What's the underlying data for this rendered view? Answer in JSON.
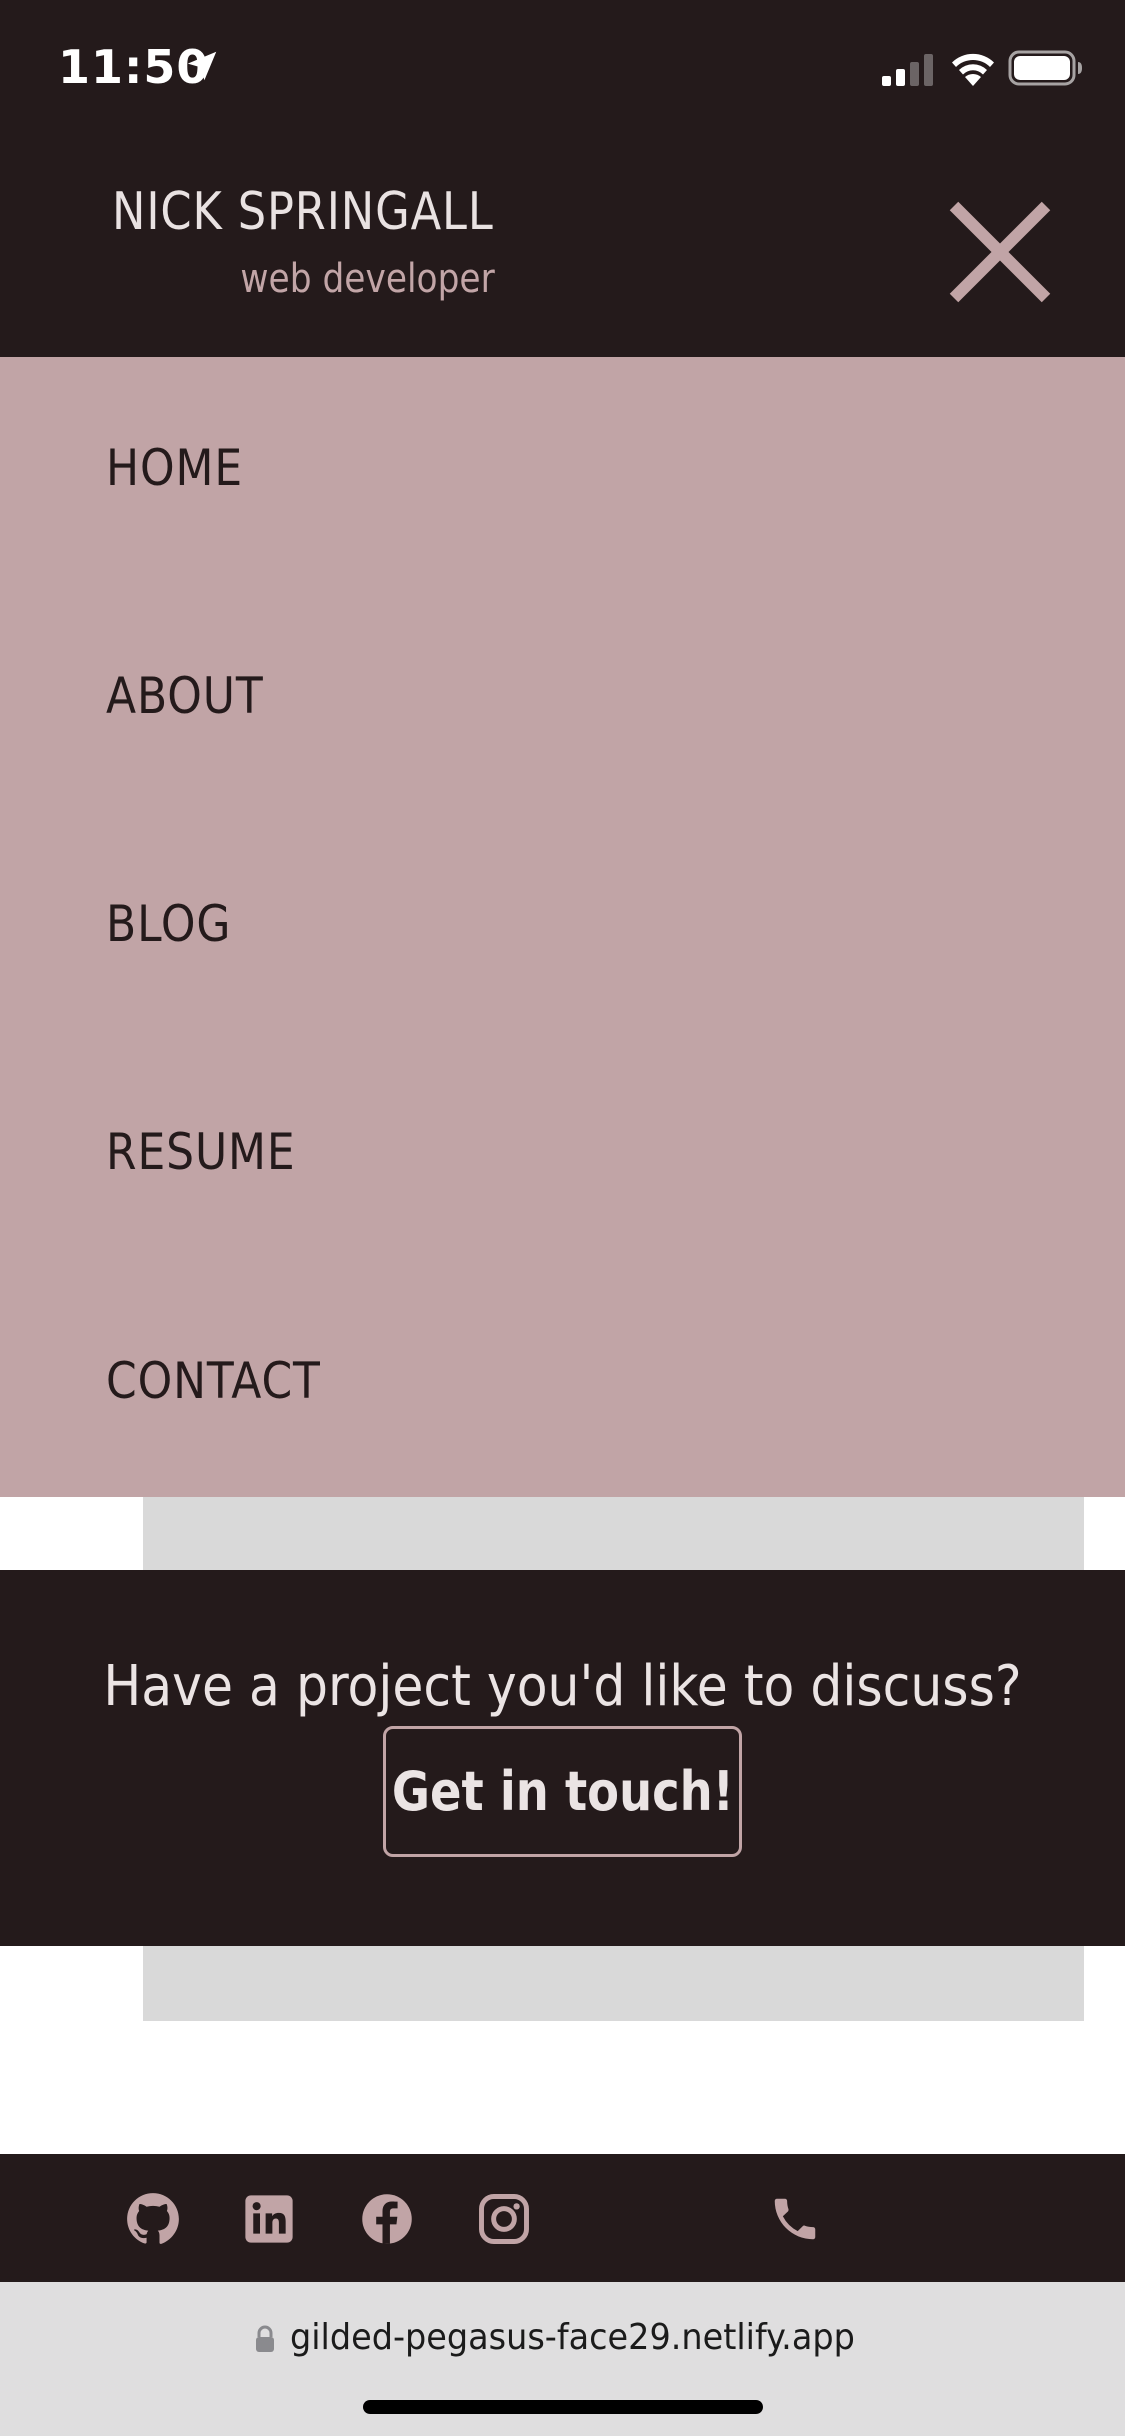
{
  "status_bar": {
    "time": "11:50",
    "icons": [
      "location-arrow-icon",
      "cellular-signal-icon",
      "wifi-icon",
      "battery-icon"
    ]
  },
  "header": {
    "name": "NICK SPRINGALL",
    "tagline": "web developer",
    "close_icon": "close-icon"
  },
  "nav": {
    "items": [
      {
        "label": "HOME"
      },
      {
        "label": "ABOUT"
      },
      {
        "label": "BLOG"
      },
      {
        "label": "RESUME"
      },
      {
        "label": "CONTACT"
      }
    ]
  },
  "cta": {
    "text": "Have a project you'd like to discuss?",
    "button_label": "Get in touch!"
  },
  "footer": {
    "social_icons": [
      "github-icon",
      "linkedin-icon",
      "facebook-icon",
      "instagram-icon",
      "phone-icon"
    ]
  },
  "browser": {
    "url": "gilded-pegasus-face29.netlify.app"
  },
  "colors": {
    "dark": "#241a1b",
    "accent": "#c1a4a6",
    "strip": "#d9d9d9",
    "browser_bar": "#dfdedf"
  }
}
